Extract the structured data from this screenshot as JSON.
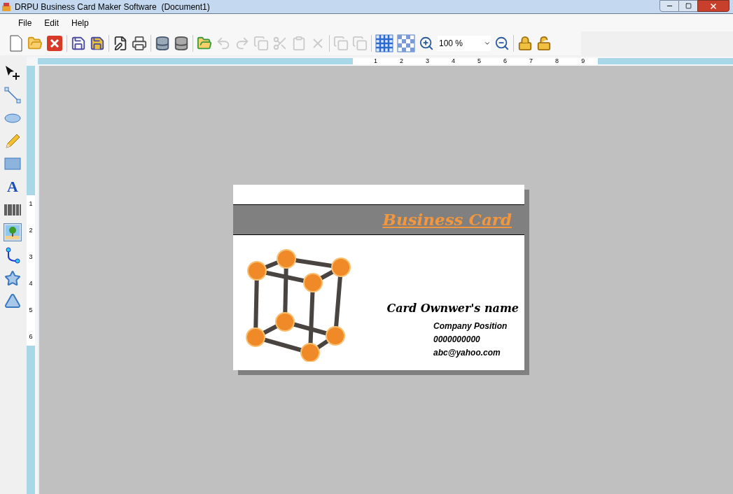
{
  "window": {
    "title": "DRPU Business Card Maker Software  (Document1)"
  },
  "menu": [
    "File",
    "Edit",
    "Help"
  ],
  "toolbar": [
    {
      "kind": "new",
      "disabled": false
    },
    {
      "kind": "open",
      "disabled": false
    },
    {
      "kind": "close",
      "disabled": false
    },
    {
      "kind": "sep"
    },
    {
      "kind": "save",
      "disabled": false
    },
    {
      "kind": "save-as",
      "disabled": false
    },
    {
      "kind": "sep"
    },
    {
      "kind": "edit",
      "disabled": false
    },
    {
      "kind": "print",
      "disabled": false
    },
    {
      "kind": "sep"
    },
    {
      "kind": "db-add",
      "disabled": false
    },
    {
      "kind": "db",
      "disabled": false
    },
    {
      "kind": "sep"
    },
    {
      "kind": "export",
      "disabled": false
    },
    {
      "kind": "undo",
      "disabled": true
    },
    {
      "kind": "redo",
      "disabled": true
    },
    {
      "kind": "copy",
      "disabled": true
    },
    {
      "kind": "cut",
      "disabled": true
    },
    {
      "kind": "paste",
      "disabled": true
    },
    {
      "kind": "delete",
      "disabled": true
    },
    {
      "kind": "sep"
    },
    {
      "kind": "front",
      "disabled": true
    },
    {
      "kind": "back",
      "disabled": true
    },
    {
      "kind": "sep"
    },
    {
      "kind": "grid",
      "disabled": false
    },
    {
      "kind": "checker",
      "disabled": false
    },
    {
      "kind": "zoom-in",
      "disabled": false
    },
    {
      "kind": "zoom",
      "value": "100 %"
    },
    {
      "kind": "zoom-out",
      "disabled": false
    },
    {
      "kind": "sep"
    },
    {
      "kind": "lock",
      "disabled": false
    },
    {
      "kind": "unlock",
      "disabled": false
    }
  ],
  "tools": [
    {
      "kind": "pointer",
      "selected": false
    },
    {
      "kind": "line",
      "selected": false
    },
    {
      "kind": "ellipse",
      "selected": false
    },
    {
      "kind": "pencil",
      "selected": false
    },
    {
      "kind": "rectangle",
      "selected": false
    },
    {
      "kind": "text",
      "selected": false,
      "glyph": "A"
    },
    {
      "kind": "barcode",
      "selected": false
    },
    {
      "kind": "image",
      "selected": true
    },
    {
      "kind": "curve",
      "selected": false
    },
    {
      "kind": "star",
      "selected": false
    },
    {
      "kind": "triangle",
      "selected": false
    }
  ],
  "ruler_h": [
    "1",
    "2",
    "3",
    "4",
    "5",
    "6",
    "7",
    "8",
    "9"
  ],
  "ruler_v": [
    "1",
    "2",
    "3",
    "4",
    "5",
    "6"
  ],
  "card": {
    "title": "Business Card",
    "name": "Card Ownwer's name",
    "lines": [
      "Company Position",
      "0000000000",
      "abc@yahoo.com"
    ]
  }
}
